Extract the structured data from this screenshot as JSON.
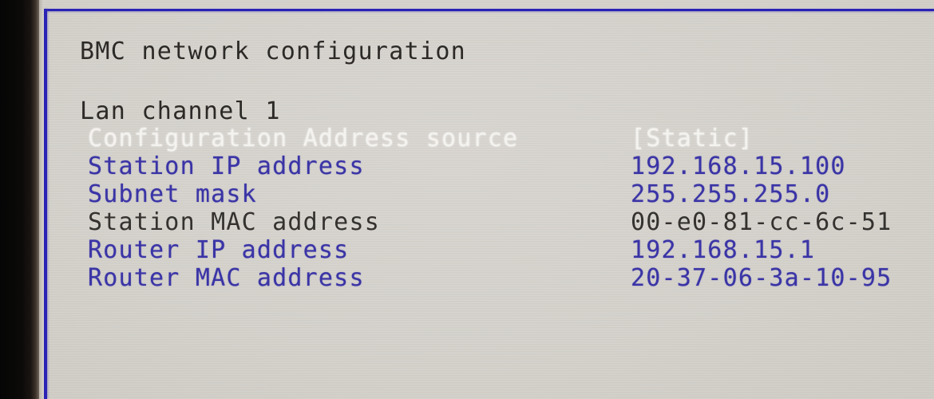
{
  "screen": {
    "title": "BMC network configuration",
    "section_label": "Lan channel 1",
    "background_color": "#d5d2cc",
    "frame_color": "#2a22b4",
    "blue_text_color": "#3a34a6",
    "dark_text_color": "#34322f",
    "selected_text_color": "#f4f3ef"
  },
  "rows": [
    {
      "label": "Configuration Address source",
      "value": "[Static]",
      "state": "selected",
      "editable": true
    },
    {
      "label": "Station IP address",
      "value": "192.168.15.100",
      "state": "normal",
      "editable": true
    },
    {
      "label": "Subnet mask",
      "value": "255.255.255.0",
      "state": "normal",
      "editable": true
    },
    {
      "label": "Station MAC address",
      "value": "00-e0-81-cc-6c-51",
      "state": "readonly",
      "editable": false
    },
    {
      "label": "Router IP address",
      "value": "192.168.15.1",
      "state": "normal",
      "editable": true
    },
    {
      "label": "Router MAC address",
      "value": "20-37-06-3a-10-95",
      "state": "normal",
      "editable": true
    }
  ]
}
